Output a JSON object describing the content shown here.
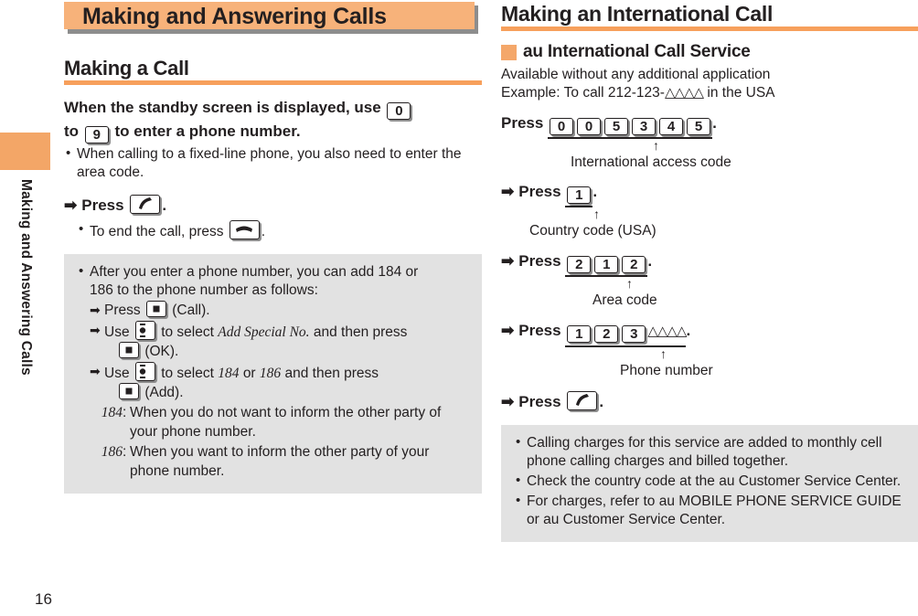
{
  "page": {
    "number": "16",
    "side_tab_label": "Making and Answering Calls",
    "colors": {
      "orange_banner": "#f7b27a",
      "orange_rule": "#f7a05c",
      "orange_tab": "#f3a667",
      "gray_box": "#e2e2e2",
      "gray_shadow": "#8d8d8d",
      "text": "#231f20"
    }
  },
  "left": {
    "banner_title": "Making and Answering Calls",
    "section_title": "Making a Call",
    "lead": {
      "part1": "When the standby screen is displayed, use",
      "key_0": "0",
      "part2": "to",
      "key_9": "9",
      "part3": "to enter a phone number."
    },
    "note_bullet": "When calling to a fixed-line phone, you also need to enter the area code.",
    "step_press": "Press",
    "step_press_key": "call-key",
    "end_call_bullet_pre": "To end the call, press",
    "end_call_key": "end-key",
    "gray_box": {
      "bullet_line1": "After you enter a phone number, you can add 184 or",
      "bullet_line2": "186 to the phone number as follows:",
      "s1_pre": "Press",
      "s1_post": "(Call).",
      "s2_pre": "Use",
      "s2_mid": "to select",
      "s2_ital": "Add Special No.",
      "s2_after": "and then press",
      "s2_cont": "(OK).",
      "s3_pre": "Use",
      "s3_mid": "to select",
      "s3_ital_a": "184",
      "s3_or": "or",
      "s3_ital_b": "186",
      "s3_after": "and then press",
      "s3_cont": "(Add).",
      "def1_term": "184",
      "def1_body": "When you do not want to inform the other party of your phone number.",
      "def2_term": "186",
      "def2_body": "When you want to inform the other party of your phone number."
    }
  },
  "right": {
    "section_title": "Making an International Call",
    "sub_title": "au International Call Service",
    "intro_line1": "Available without any additional application",
    "intro_line2_pre": "Example: To call 212-123-",
    "intro_line2_tri": "△△△△",
    "intro_line2_post": " in the USA",
    "steps": [
      {
        "label": "Press",
        "keys": [
          "0",
          "0",
          "5",
          "3",
          "4",
          "5"
        ],
        "caption": "International access code",
        "caption_index": 2
      },
      {
        "label": "Press",
        "keys": [
          "1"
        ],
        "caption": "Country code (USA)",
        "caption_index": 0
      },
      {
        "label": "Press",
        "keys": [
          "2",
          "1",
          "2"
        ],
        "caption": "Area code",
        "caption_index": 1
      },
      {
        "label": "Press",
        "keys": [
          "1",
          "2",
          "3"
        ],
        "suffix": "△△△△",
        "caption": "Phone number",
        "caption_index": 2
      }
    ],
    "final_step": "Press",
    "final_step_key": "call-key",
    "gray_box": {
      "b1": "Calling charges for this service are added to monthly cell phone calling charges and billed together.",
      "b2": "Check the country code at the au Customer Service Center.",
      "b3": "For charges, refer to au MOBILE PHONE SERVICE GUIDE or au Customer Service Center."
    }
  },
  "icons": {
    "arrow_right": "➡",
    "arrow_right_small": "➡",
    "arrow_up": "↑",
    "bullet": "•",
    "triangle": "△"
  }
}
